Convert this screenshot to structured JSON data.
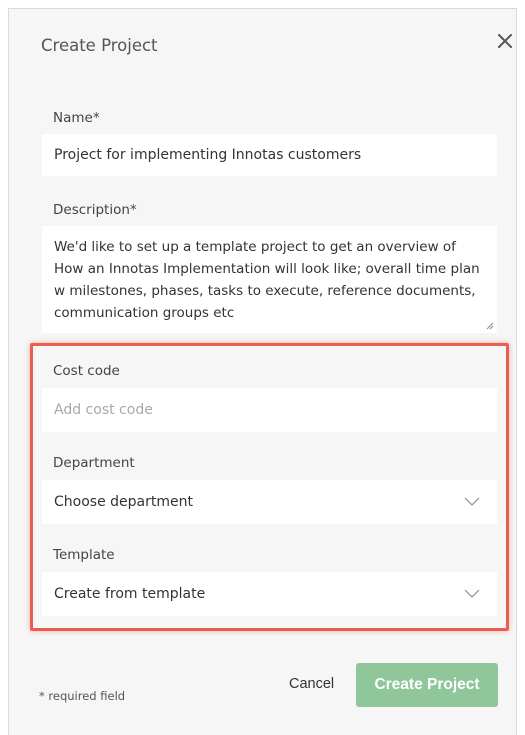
{
  "dialog": {
    "title": "Create Project"
  },
  "form": {
    "name": {
      "label": "Name*",
      "value": "Project for implementing Innotas customers"
    },
    "description": {
      "label": "Description*",
      "value": "We'd like to set up a template project to get an overview of How an Innotas Implementation will look like; overall time plan w milestones, phases, tasks to execute, reference documents, communication groups etc",
      "lines": [
        "We'd like to set up a template project to get an overview of",
        "How an Innotas Implementation will look like; overall time plan",
        "w milestones, phases, tasks to execute, reference documents,",
        "communication groups etc"
      ]
    },
    "cost_code": {
      "label": "Cost code",
      "placeholder": "Add cost code",
      "value": ""
    },
    "department": {
      "label": "Department",
      "selected": "Choose department"
    },
    "template": {
      "label": "Template",
      "selected": "Create from template"
    }
  },
  "footer": {
    "required_note": "* required field",
    "cancel_label": "Cancel",
    "submit_label": "Create Project"
  },
  "icons": {
    "close": "close-icon",
    "chevron": "chevron-down-icon"
  },
  "colors": {
    "dialog_background": "#f6f6f6",
    "field_background": "#ffffff",
    "primary_button": "#8fc69a",
    "highlight_border": "#e95f4f"
  }
}
